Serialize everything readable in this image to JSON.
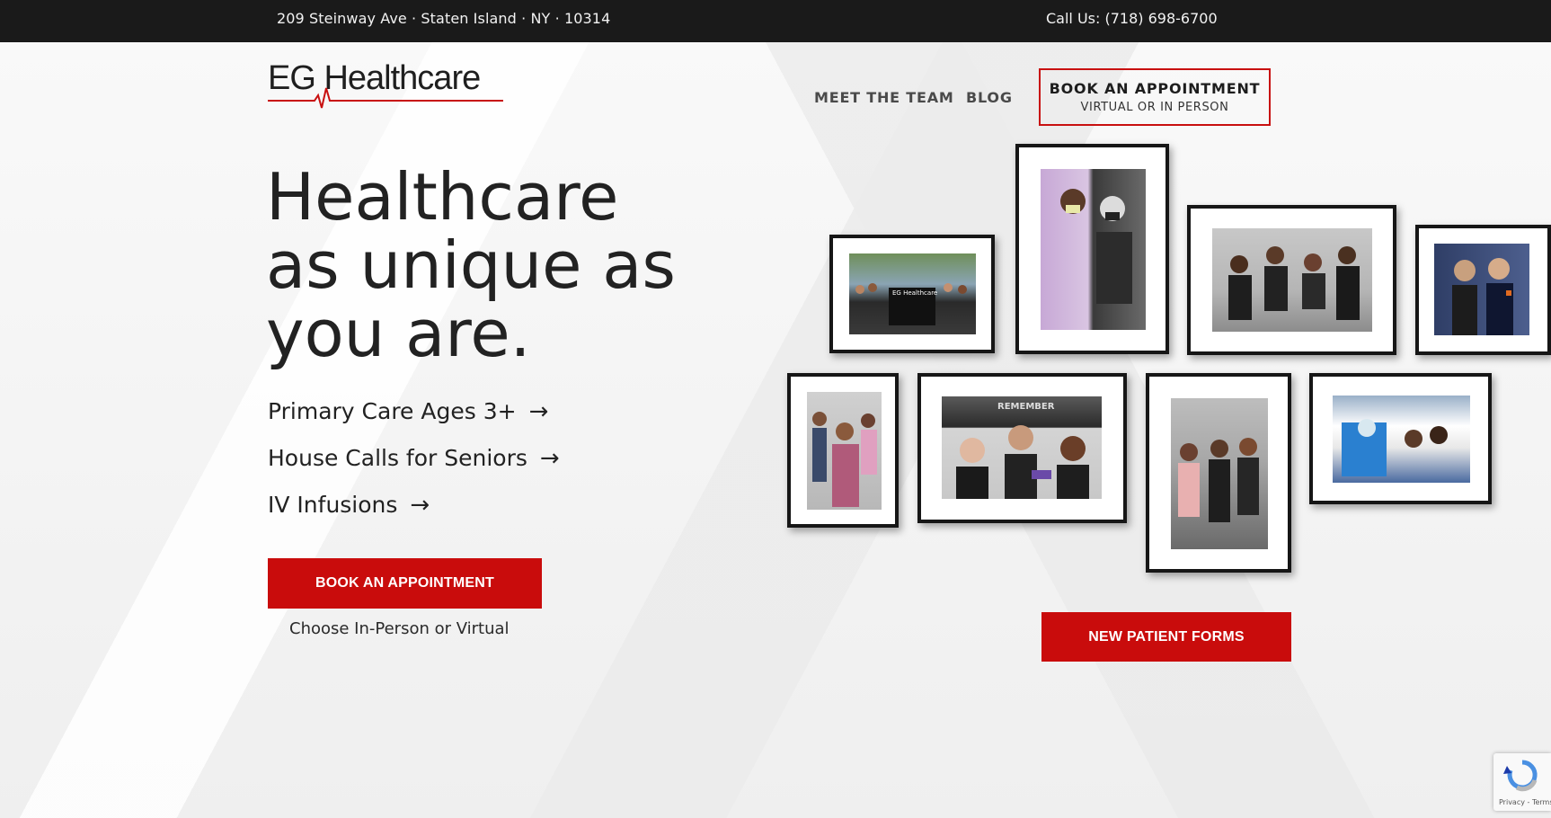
{
  "topbar": {
    "address": "209 Steinway Ave  ·  Staten Island  ·  NY  ·  10314",
    "phone": "Call Us: (718) 698-6700"
  },
  "logo": {
    "text": "EG Healthcare"
  },
  "nav": {
    "meet_the_team": "MEET THE TEAM",
    "blog": "BLOG",
    "book_line1": "BOOK AN APPOINTMENT",
    "book_line2": "VIRTUAL OR IN PERSON"
  },
  "hero": {
    "title_line1": "Healthcare",
    "title_line2": "as unique as",
    "title_line3": "you are.",
    "services": [
      {
        "label": "Primary Care Ages 3+",
        "arrow": "→"
      },
      {
        "label": "House Calls for Seniors",
        "arrow": "→"
      },
      {
        "label": "IV Infusions",
        "arrow": "→"
      }
    ],
    "book_button": "BOOK AN APPOINTMENT",
    "book_caption": "Choose In-Person or Virtual"
  },
  "gallery": {
    "new_patient_button": "NEW PATIENT FORMS",
    "sign_text": "EG Healthcare",
    "wall_text": "REMEMBER"
  },
  "recaptcha": {
    "text": "Privacy - Terms"
  },
  "colors": {
    "accent": "#c90c0c",
    "topbar": "#1a1a1a",
    "frame": "#161616"
  }
}
